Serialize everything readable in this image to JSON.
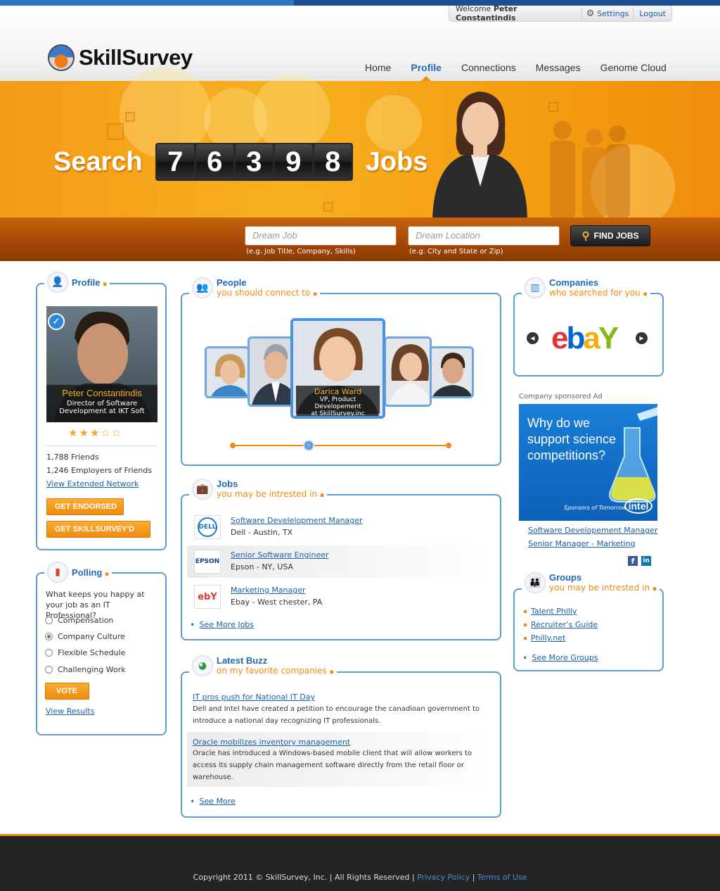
{
  "header": {
    "welcome_prefix": "Welcome",
    "user_name": "Peter Constantindis",
    "settings": "Settings",
    "logout": "Logout",
    "logo_text": "SkillSurvey",
    "nav": [
      "Home",
      "Profile",
      "Connections",
      "Messages",
      "Genome Cloud"
    ]
  },
  "banner": {
    "search_word": "Search",
    "digits": [
      "7",
      "6",
      "3",
      "9",
      "8"
    ],
    "jobs_word": "Jobs",
    "job_placeholder": "Dream Job",
    "job_hint": "(e.g. Job Title, Company, Skills)",
    "loc_placeholder": "Dream Location",
    "loc_hint": "(e.g. City and State or Zip)",
    "find_button": "FIND JOBS"
  },
  "profile": {
    "title": "Profile",
    "name": "Peter Constantindis",
    "role_line1": "Director of Software",
    "role_line2": "Development at IKT Soft",
    "rating": 3,
    "friends": "1,788 Friends",
    "employers": "1,246 Employers of Friends",
    "view_network": "View Extended Network",
    "endorsed_button": "GET ENDORSED",
    "skillsurveyd_button": "GET SKILLSURVEY'D"
  },
  "polling": {
    "title": "Polling",
    "question": "What keeps you happy at your job as an IT Professional?",
    "options": [
      "Compensation",
      "Company Culture",
      "Flexible Schedule",
      "Challenging Work"
    ],
    "selected": 1,
    "vote_button": "VOTE",
    "view_results": "View Results"
  },
  "people": {
    "title": "People",
    "subtitle": "you should connect to",
    "featured_name": "Darica Ward",
    "featured_role1": "VP, Product Developement",
    "featured_role2": "at SkillSurvey.inc"
  },
  "jobs": {
    "title": "Jobs",
    "subtitle": "you may be intrested in",
    "items": [
      {
        "logo": "DELL",
        "title": "Software Develelopment Manager",
        "detail": "Dell - Austin, TX"
      },
      {
        "logo": "EPSON",
        "title": "Senior Software Engineer",
        "detail": "Epson - NY, USA"
      },
      {
        "logo": "ebY",
        "title": "Marketing Manager",
        "detail": "Ebay - West chester, PA"
      }
    ],
    "see_more": "See More Jobs"
  },
  "buzz": {
    "title": "Latest Buzz",
    "subtitle": "on my favorite companies",
    "items": [
      {
        "title": "IT pros push for National IT Day",
        "body1": "Dell and Intel have created a petition to encourage the canadioan government to",
        "body2": "introduce a national day recognizing IT professionals.",
        "body3": ""
      },
      {
        "title": "Oracle mobilizes inventory management",
        "body1": "Oracle has introduced a Windows-based mobile client that will allow workers to",
        "body2": "access its supply chain management software directly from the retail floor or",
        "body3": "warehouse."
      }
    ],
    "see_more": "See More"
  },
  "companies": {
    "title": "Companies",
    "subtitle": "who searched for you",
    "logo": "ebay"
  },
  "ad": {
    "label": "Company sponsored Ad",
    "headline1": "Why do we",
    "headline2": "support science",
    "headline3": "competitions?",
    "tagline": "Sponsors of Tomorrow.",
    "brand": "intel",
    "link1": "Software Developement Manager",
    "link2": "Senior Manager - Marketing"
  },
  "groups": {
    "title": "Groups",
    "subtitle": "you may be intrested in",
    "items": [
      "Talent Philly",
      "Recruiter’s Guide",
      "Philly.net"
    ],
    "see_more": "See More Groups"
  },
  "footer": {
    "copyright": "Copyright 2011 © SkillSurvey, Inc. | All Rights Reserved |",
    "privacy": "Privacy Policy",
    "terms": "Terms of Use"
  },
  "colors": {
    "accent_blue": "#1f6ab7",
    "accent_orange": "#f08a10",
    "box_border": "#5e99d3"
  }
}
